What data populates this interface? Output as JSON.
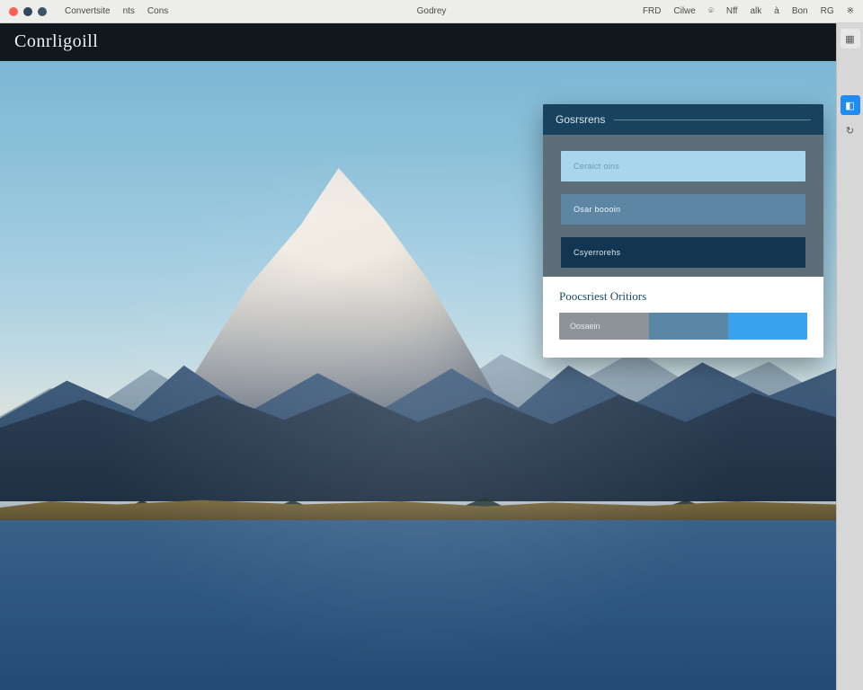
{
  "os_menu": {
    "left_items": [
      "Convertsite",
      "nts",
      "Cons"
    ],
    "center": "Godrey",
    "right_items": [
      "FRD",
      "Cilwe",
      "⌾",
      "Nff",
      "alk",
      "à",
      "Bon",
      "RG",
      "※"
    ]
  },
  "app": {
    "title": "Conrligoill"
  },
  "panel": {
    "header": "Gosrsrens",
    "swatches": [
      {
        "label": "Ceraict oins",
        "color": "#a8d6ec"
      },
      {
        "label": "Osar boooin",
        "color": "#5d86a5"
      },
      {
        "label": "Csyerrorehs",
        "color": "#123552"
      }
    ],
    "subtitle": "Poocsriest Oritiors",
    "options": [
      {
        "label": "Oosaein",
        "color": "#8d9398"
      },
      {
        "label": "",
        "color": "#5a87a5"
      },
      {
        "label": "",
        "color": "#3aa3ef"
      }
    ]
  },
  "rail": {
    "buttons": [
      {
        "name": "grid-icon",
        "glyph": "▦",
        "accent": false
      },
      {
        "name": "spacer"
      },
      {
        "name": "palette-icon",
        "glyph": "◧",
        "accent": true
      },
      {
        "name": "history-icon",
        "glyph": "↻",
        "accent": false
      }
    ]
  }
}
